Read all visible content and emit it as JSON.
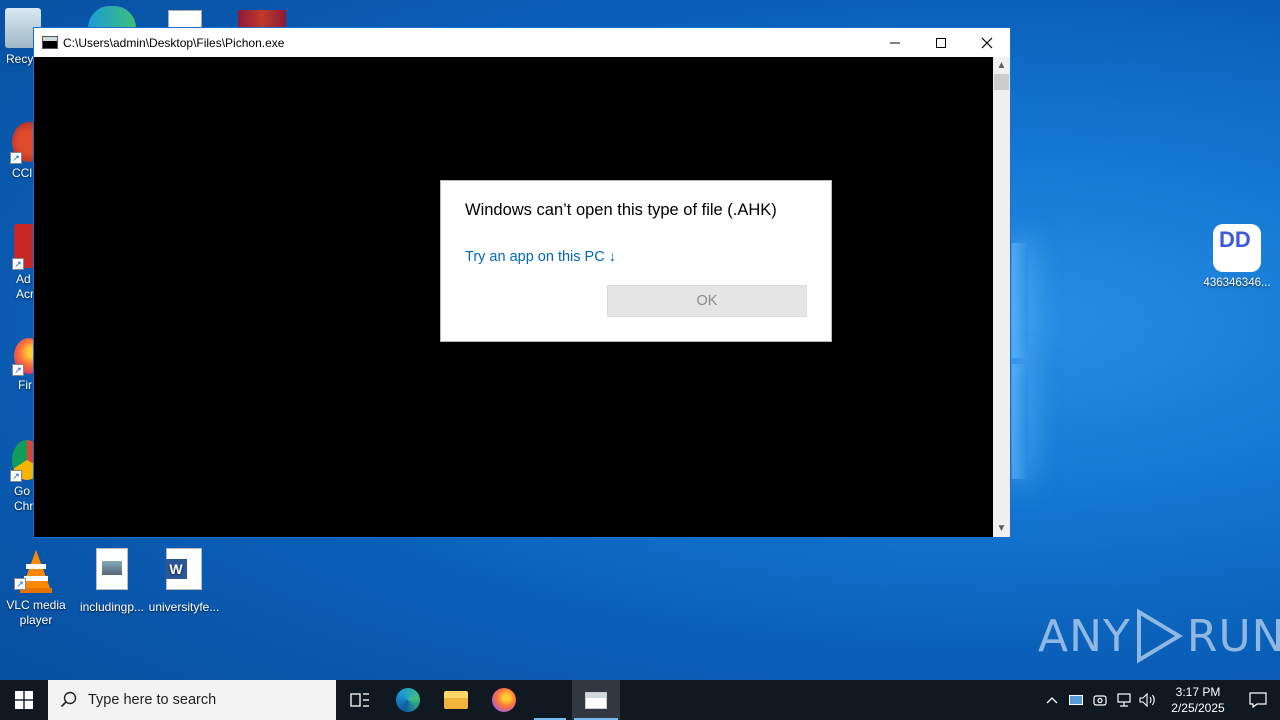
{
  "console_window": {
    "title": "C:\\Users\\admin\\Desktop\\Files\\Pichon.exe",
    "minimize_symbol": "—",
    "maximize_symbol": "☐",
    "close_symbol": "✕"
  },
  "dialog": {
    "message": "Windows can’t open this type of file (.AHK)",
    "link": "Try an app on this PC ↓",
    "ok_label": "OK"
  },
  "desktop_icons": {
    "recycle": "Recy",
    "ccleaner": "CCl",
    "acrobat": "Ad\nAcr",
    "firefox": "Fir",
    "chrome": "Go\nChr",
    "vlc": "VLC media player",
    "including": "includingp...",
    "university": "universityfe...",
    "app_436": "436346346..."
  },
  "watermark": {
    "left": "ANY",
    "right": "RUN"
  },
  "taskbar": {
    "search_placeholder": "Type here to search",
    "time": "3:17 PM",
    "date": "2/25/2025"
  },
  "icons": {
    "start": "windows-start-icon",
    "search": "search-icon",
    "taskview": "task-view-icon",
    "edge": "edge-icon",
    "explorer": "file-explorer-icon",
    "firefox": "firefox-icon",
    "console": "console-app-icon"
  }
}
